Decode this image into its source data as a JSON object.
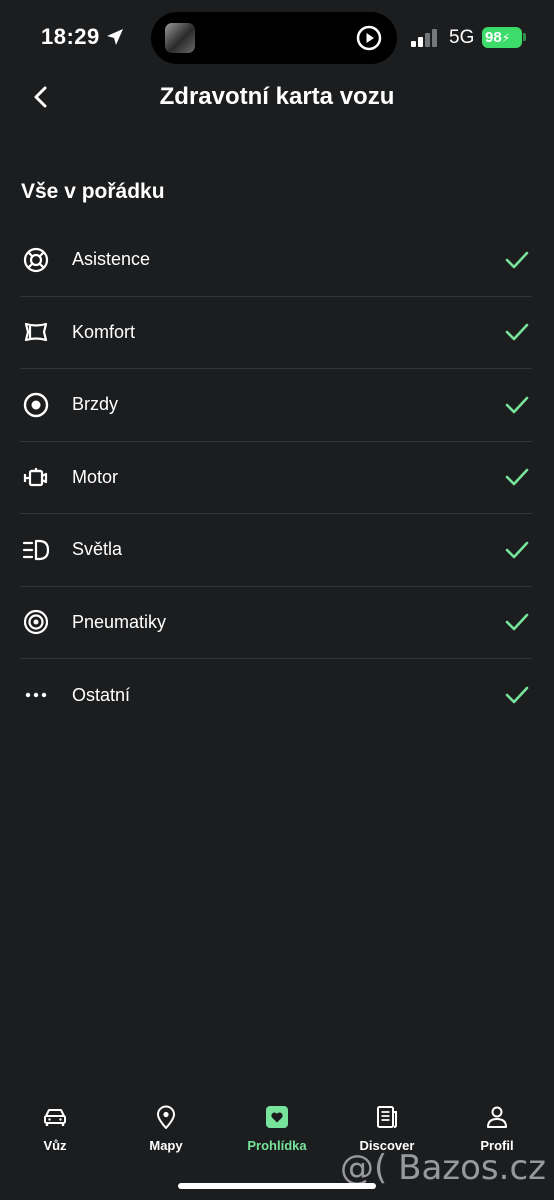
{
  "status_bar": {
    "time": "18:29",
    "network": "5G",
    "battery": "98"
  },
  "header": {
    "title": "Zdravotní karta vozu"
  },
  "section": {
    "title": "Vše v pořádku"
  },
  "items": [
    {
      "label": "Asistence",
      "icon": "lifebuoy-icon"
    },
    {
      "label": "Komfort",
      "icon": "seat-icon"
    },
    {
      "label": "Brzdy",
      "icon": "brake-disc-icon"
    },
    {
      "label": "Motor",
      "icon": "engine-icon"
    },
    {
      "label": "Světla",
      "icon": "headlight-icon"
    },
    {
      "label": "Pneumatiky",
      "icon": "tire-icon"
    },
    {
      "label": "Ostatní",
      "icon": "more-dots-icon"
    }
  ],
  "nav": [
    {
      "label": "Vůz",
      "icon": "car-icon",
      "active": false
    },
    {
      "label": "Mapy",
      "icon": "map-pin-icon",
      "active": false
    },
    {
      "label": "Prohlídka",
      "icon": "heart-card-icon",
      "active": true
    },
    {
      "label": "Discover",
      "icon": "newspaper-icon",
      "active": false
    },
    {
      "label": "Profil",
      "icon": "person-icon",
      "active": false
    }
  ],
  "watermark": "@( Bazos.cz",
  "colors": {
    "background": "#1c1d1f",
    "accent": "#78e39b",
    "battery": "#3ddc6a",
    "divider": "#333438"
  }
}
